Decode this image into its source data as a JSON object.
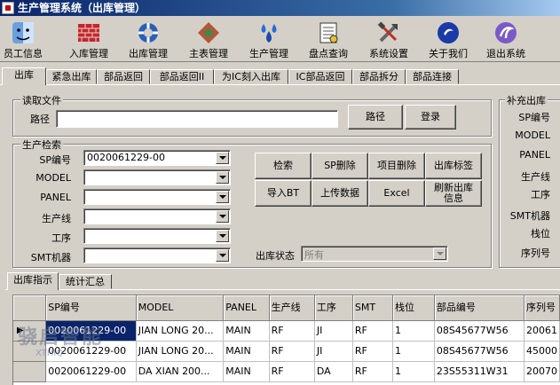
{
  "window": {
    "title": "生产管理系统（出库管理）"
  },
  "toolbar": {
    "buttons": [
      {
        "label": "员工信息",
        "icon": "finder-face-icon"
      },
      {
        "label": "入库管理",
        "icon": "brick-wall-icon"
      },
      {
        "label": "出库管理",
        "icon": "lifebuoy-icon"
      },
      {
        "label": "主表管理",
        "icon": "diamond-star-icon"
      },
      {
        "label": "生产管理",
        "icon": "water-drops-icon"
      },
      {
        "label": "盘点查询",
        "icon": "document-icon"
      },
      {
        "label": "系统设置",
        "icon": "tools-icon"
      },
      {
        "label": "关于我们",
        "icon": "blue-ball-icon"
      },
      {
        "label": "退出系统",
        "icon": "exit-swirl-icon"
      }
    ]
  },
  "tabs": [
    "出库",
    "紧急出库",
    "部品返回",
    "部品返回II",
    "为IC刻入出库",
    "IC部品返回",
    "部品拆分",
    "部品连接"
  ],
  "read_file": {
    "title": "读取文件",
    "path_label": "路径",
    "path_value": "",
    "path_button": "路径",
    "login_button": "登录"
  },
  "search": {
    "title": "生产检索",
    "fields": [
      {
        "label": "SP编号",
        "value": "0020061229-00"
      },
      {
        "label": "MODEL",
        "value": ""
      },
      {
        "label": "PANEL",
        "value": ""
      },
      {
        "label": "生产线",
        "value": ""
      },
      {
        "label": "工序",
        "value": ""
      },
      {
        "label": "SMT机器",
        "value": ""
      }
    ],
    "buttons": [
      "检索",
      "SP删除",
      "项目删除",
      "出库标签",
      "导入BT",
      "上传数据",
      "Excel",
      "刷新出库信息"
    ],
    "status_label": "出库状态",
    "status_value": "所有"
  },
  "supplement": {
    "title": "补充出库",
    "labels": [
      "SP编号",
      "MODEL",
      "PANEL",
      "生产线",
      "工序",
      "SMT机器",
      "栈位",
      "序列号"
    ]
  },
  "bottom_tabs": [
    "出库指示",
    "统计汇总"
  ],
  "grid": {
    "columns": [
      "SP编号",
      "MODEL",
      "PANEL",
      "生产线",
      "工序",
      "SMT",
      "栈位",
      "部品编号",
      "序列号"
    ],
    "rows": [
      [
        "0020061229-00",
        "JIAN LONG 20...",
        "MAIN",
        "RF",
        "JI",
        "RF",
        "1",
        "08S45677W56",
        "20061"
      ],
      [
        "0020061229-00",
        "JIAN LONG 20...",
        "MAIN",
        "RF",
        "JI",
        "RF",
        "1",
        "08S45677W56",
        "45000"
      ],
      [
        "0020061229-00",
        "DA XIAN  200...",
        "MAIN",
        "RF",
        "DA",
        "RF",
        "1",
        "23S55311W31",
        "20070"
      ]
    ]
  },
  "watermark": {
    "text": "骁启智能",
    "sub": "XTHIQ"
  }
}
